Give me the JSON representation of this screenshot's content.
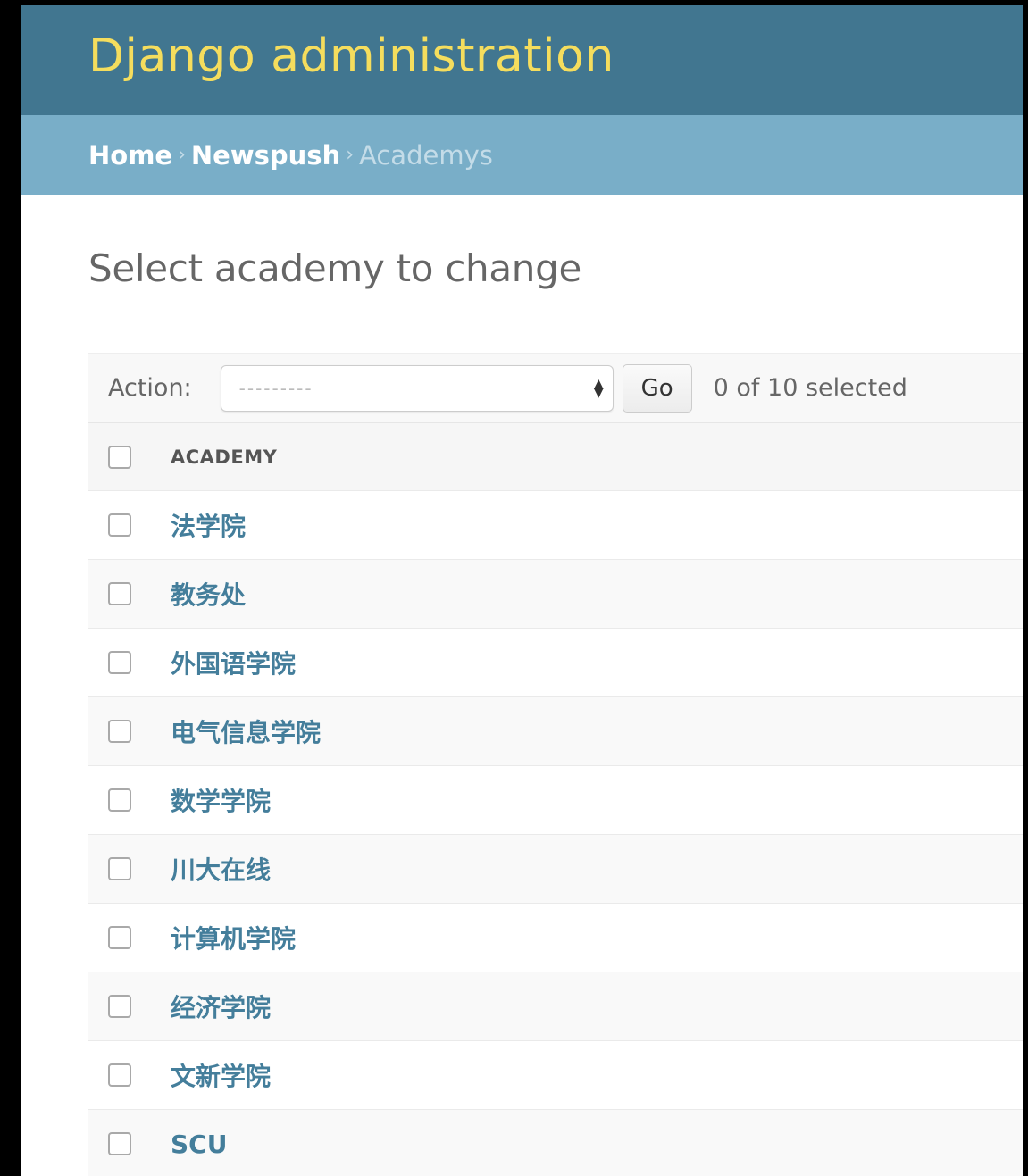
{
  "site": {
    "title": "Django administration"
  },
  "breadcrumbs": {
    "home": "Home",
    "app": "Newspush",
    "current": "Academys",
    "separator": "›"
  },
  "page": {
    "title": "Select academy to change"
  },
  "actions": {
    "label": "Action:",
    "select_placeholder": "---------",
    "go_label": "Go",
    "selection_count": "0 of 10 selected"
  },
  "table": {
    "column_header": "ACADEMY",
    "rows": [
      {
        "label": "法学院"
      },
      {
        "label": "教务处"
      },
      {
        "label": "外国语学院"
      },
      {
        "label": "电气信息学院"
      },
      {
        "label": "数学学院"
      },
      {
        "label": "川大在线"
      },
      {
        "label": "计算机学院"
      },
      {
        "label": "经济学院"
      },
      {
        "label": "文新学院"
      },
      {
        "label": "SCU"
      }
    ]
  },
  "colors": {
    "header_bg": "#417690",
    "title_yellow": "#f5dd5d",
    "breadcrumb_bg": "#79aec8",
    "link_blue": "#447e9b"
  }
}
